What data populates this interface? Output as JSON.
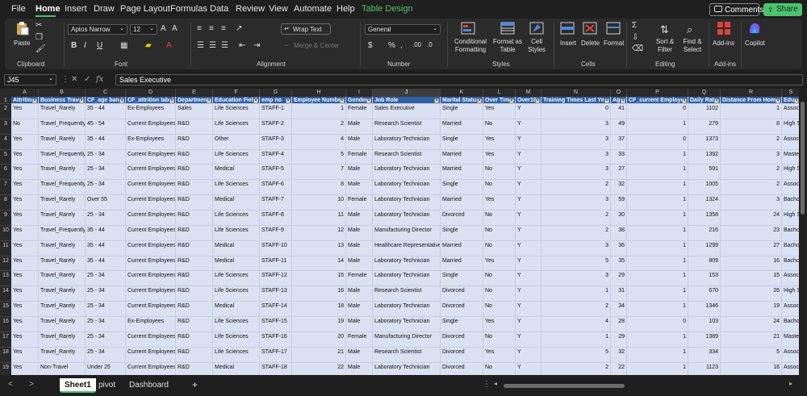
{
  "menu": {
    "tabs": [
      "File",
      "Home",
      "Insert",
      "Draw",
      "Page Layout",
      "Formulas",
      "Data",
      "Review",
      "View",
      "Automate",
      "Help",
      "Table Design"
    ],
    "comments": "Comments",
    "share": "Share"
  },
  "ribbon": {
    "clipboard": {
      "paste": "Paste",
      "label": "Clipboard"
    },
    "font": {
      "name": "Aptos Narrow",
      "size": "12",
      "label": "Font"
    },
    "alignment": {
      "wrap": "Wrap Text",
      "merge": "Merge & Center",
      "label": "Alignment"
    },
    "number": {
      "format": "General",
      "label": "Number"
    },
    "styles": {
      "cond": "Conditional Formatting",
      "fmt_table": "Format as Table",
      "cell_styles": "Cell Styles",
      "label": "Styles"
    },
    "cells": {
      "insert": "Insert",
      "delete": "Delete",
      "format": "Format",
      "label": "Cells"
    },
    "editing": {
      "sort": "Sort & Filter",
      "find": "Find & Select",
      "label": "Editing"
    },
    "addins": {
      "addins": "Add-ins",
      "label": "Add-ins"
    },
    "copilot": {
      "label": "Copilot"
    }
  },
  "formula_bar": {
    "name_box": "J45",
    "formula": "Sales Executive"
  },
  "columns": [
    {
      "letter": "A",
      "header": "Attrition",
      "w": 34,
      "align": "l"
    },
    {
      "letter": "B",
      "header": "Business Travel",
      "w": 58,
      "align": "l"
    },
    {
      "letter": "C",
      "header": "CF_age band",
      "w": 50,
      "align": "l"
    },
    {
      "letter": "D",
      "header": "CF_attrition label",
      "w": 62,
      "align": "l"
    },
    {
      "letter": "E",
      "header": "Department",
      "w": 46,
      "align": "l"
    },
    {
      "letter": "F",
      "header": "Education Field",
      "w": 58,
      "align": "l"
    },
    {
      "letter": "G",
      "header": "emp no",
      "w": 40,
      "align": "l"
    },
    {
      "letter": "H",
      "header": "Employee Number",
      "w": 67,
      "align": "r"
    },
    {
      "letter": "I",
      "header": "Gender",
      "w": 33,
      "align": "l"
    },
    {
      "letter": "J",
      "header": "Job Role",
      "w": 84,
      "align": "l"
    },
    {
      "letter": "K",
      "header": "Marital Status",
      "w": 53,
      "align": "l"
    },
    {
      "letter": "L",
      "header": "Over Time",
      "w": 40,
      "align": "l"
    },
    {
      "letter": "M",
      "header": "Over18",
      "w": 32,
      "align": "l"
    },
    {
      "letter": "N",
      "header": "Training Times Last Year",
      "w": 86,
      "align": "r"
    },
    {
      "letter": "O",
      "header": "Age",
      "w": 20,
      "align": "r"
    },
    {
      "letter": "P",
      "header": "CF_current Employee",
      "w": 76,
      "align": "r"
    },
    {
      "letter": "Q",
      "header": "Daily Rate",
      "w": 40,
      "align": "r"
    },
    {
      "letter": "R",
      "header": "Distance From Home",
      "w": 76,
      "align": "r"
    },
    {
      "letter": "S",
      "header": "Educa",
      "w": 23,
      "align": "l"
    }
  ],
  "rows": [
    [
      "Yes",
      "Travel_Rarely",
      "35 - 44",
      "Ex-Employees",
      "Sales",
      "Life Sciences",
      "STAFF-1",
      "1",
      "Female",
      "Sales Executive",
      "Single",
      "Yes",
      "Y",
      "0",
      "41",
      "0",
      "1102",
      "1",
      "Assoc"
    ],
    [
      "No",
      "Travel_Frequently",
      "45 - 54",
      "Current Employees",
      "R&D",
      "Life Sciences",
      "STAFF-2",
      "2",
      "Male",
      "Research Scientist",
      "Married",
      "No",
      "Y",
      "3",
      "49",
      "1",
      "279",
      "8",
      "High S"
    ],
    [
      "Yes",
      "Travel_Rarely",
      "35 - 44",
      "Ex-Employees",
      "R&D",
      "Other",
      "STAFF-3",
      "4",
      "Male",
      "Laboratory Technician",
      "Single",
      "Yes",
      "Y",
      "3",
      "37",
      "0",
      "1373",
      "2",
      "Assoc"
    ],
    [
      "Yes",
      "Travel_Frequently",
      "25 - 34",
      "Current Employees",
      "R&D",
      "Life Sciences",
      "STAFF-4",
      "5",
      "Female",
      "Research Scientist",
      "Married",
      "Yes",
      "Y",
      "3",
      "33",
      "1",
      "1392",
      "3",
      "Maste"
    ],
    [
      "Yes",
      "Travel_Rarely",
      "25 - 34",
      "Current Employees",
      "R&D",
      "Medical",
      "STAFF-5",
      "7",
      "Male",
      "Laboratory Technician",
      "Married",
      "No",
      "Y",
      "3",
      "27",
      "1",
      "591",
      "2",
      "High S"
    ],
    [
      "Yes",
      "Travel_Frequently",
      "25 - 34",
      "Current Employees",
      "R&D",
      "Life Sciences",
      "STAFF-6",
      "8",
      "Male",
      "Laboratory Technician",
      "Single",
      "No",
      "Y",
      "2",
      "32",
      "1",
      "1005",
      "2",
      "Assoc"
    ],
    [
      "Yes",
      "Travel_Rarely",
      "Over 55",
      "Current Employees",
      "R&D",
      "Medical",
      "STAFF-7",
      "10",
      "Female",
      "Laboratory Technician",
      "Married",
      "Yes",
      "Y",
      "3",
      "59",
      "1",
      "1324",
      "3",
      "Bachc"
    ],
    [
      "Yes",
      "Travel_Rarely",
      "25 - 34",
      "Current Employees",
      "R&D",
      "Life Sciences",
      "STAFF-8",
      "11",
      "Male",
      "Laboratory Technician",
      "Divorced",
      "No",
      "Y",
      "2",
      "30",
      "1",
      "1358",
      "24",
      "High S"
    ],
    [
      "Yes",
      "Travel_Frequently",
      "35 - 44",
      "Current Employees",
      "R&D",
      "Life Sciences",
      "STAFF-9",
      "12",
      "Male",
      "Manufacturing Director",
      "Single",
      "No",
      "Y",
      "2",
      "38",
      "1",
      "216",
      "23",
      "Bachc"
    ],
    [
      "Yes",
      "Travel_Rarely",
      "35 - 44",
      "Current Employees",
      "R&D",
      "Medical",
      "STAFF-10",
      "13",
      "Male",
      "Healthcare Representative",
      "Married",
      "No",
      "Y",
      "3",
      "36",
      "1",
      "1299",
      "27",
      "Bachc"
    ],
    [
      "Yes",
      "Travel_Rarely",
      "35 - 44",
      "Current Employees",
      "R&D",
      "Medical",
      "STAFF-11",
      "14",
      "Male",
      "Laboratory Technician",
      "Married",
      "Yes",
      "Y",
      "5",
      "35",
      "1",
      "809",
      "16",
      "Bachc"
    ],
    [
      "Yes",
      "Travel_Rarely",
      "25 - 34",
      "Current Employees",
      "R&D",
      "Life Sciences",
      "STAFF-12",
      "15",
      "Female",
      "Laboratory Technician",
      "Single",
      "No",
      "Y",
      "3",
      "29",
      "1",
      "153",
      "15",
      "Assoc"
    ],
    [
      "Yes",
      "Travel_Rarely",
      "25 - 34",
      "Current Employees",
      "R&D",
      "Life Sciences",
      "STAFF-13",
      "16",
      "Male",
      "Research Scientist",
      "Divorced",
      "No",
      "Y",
      "1",
      "31",
      "1",
      "670",
      "26",
      "High S"
    ],
    [
      "Yes",
      "Travel_Rarely",
      "25 - 34",
      "Current Employees",
      "R&D",
      "Medical",
      "STAFF-14",
      "18",
      "Male",
      "Laboratory Technician",
      "Divorced",
      "No",
      "Y",
      "2",
      "34",
      "1",
      "1346",
      "19",
      "Assoc"
    ],
    [
      "Yes",
      "Travel_Rarely",
      "25 - 34",
      "Ex-Employees",
      "R&D",
      "Life Sciences",
      "STAFF-15",
      "19",
      "Male",
      "Laboratory Technician",
      "Single",
      "Yes",
      "Y",
      "4",
      "28",
      "0",
      "103",
      "24",
      "Bachc"
    ],
    [
      "Yes",
      "Travel_Rarely",
      "25 - 34",
      "Current Employees",
      "R&D",
      "Life Sciences",
      "STAFF-16",
      "20",
      "Female",
      "Manufacturing Director",
      "Divorced",
      "No",
      "Y",
      "1",
      "29",
      "1",
      "1389",
      "21",
      "Maste"
    ],
    [
      "Yes",
      "Travel_Rarely",
      "25 - 34",
      "Current Employees",
      "R&D",
      "Life Sciences",
      "STAFF-17",
      "21",
      "Male",
      "Research Scientist",
      "Divorced",
      "Yes",
      "Y",
      "5",
      "32",
      "1",
      "334",
      "5",
      "Assoc"
    ],
    [
      "Yes",
      "Non-Travel",
      "Under 25",
      "Current Employees",
      "R&D",
      "Medical",
      "STAFF-18",
      "22",
      "Male",
      "Laboratory Technician",
      "Divorced",
      "No",
      "Y",
      "2",
      "22",
      "1",
      "1123",
      "16",
      "Assoc"
    ]
  ],
  "row_numbers": [
    "1",
    "2",
    "3",
    "4",
    "5",
    "6",
    "7",
    "8",
    "9",
    "10",
    "11",
    "12",
    "13",
    "14",
    "15",
    "16",
    "17",
    "18",
    "19"
  ],
  "sheet_tabs": [
    "Sheet1",
    "pivot",
    "Dashboard"
  ],
  "add_sheet": "+",
  "selected_column": "J"
}
